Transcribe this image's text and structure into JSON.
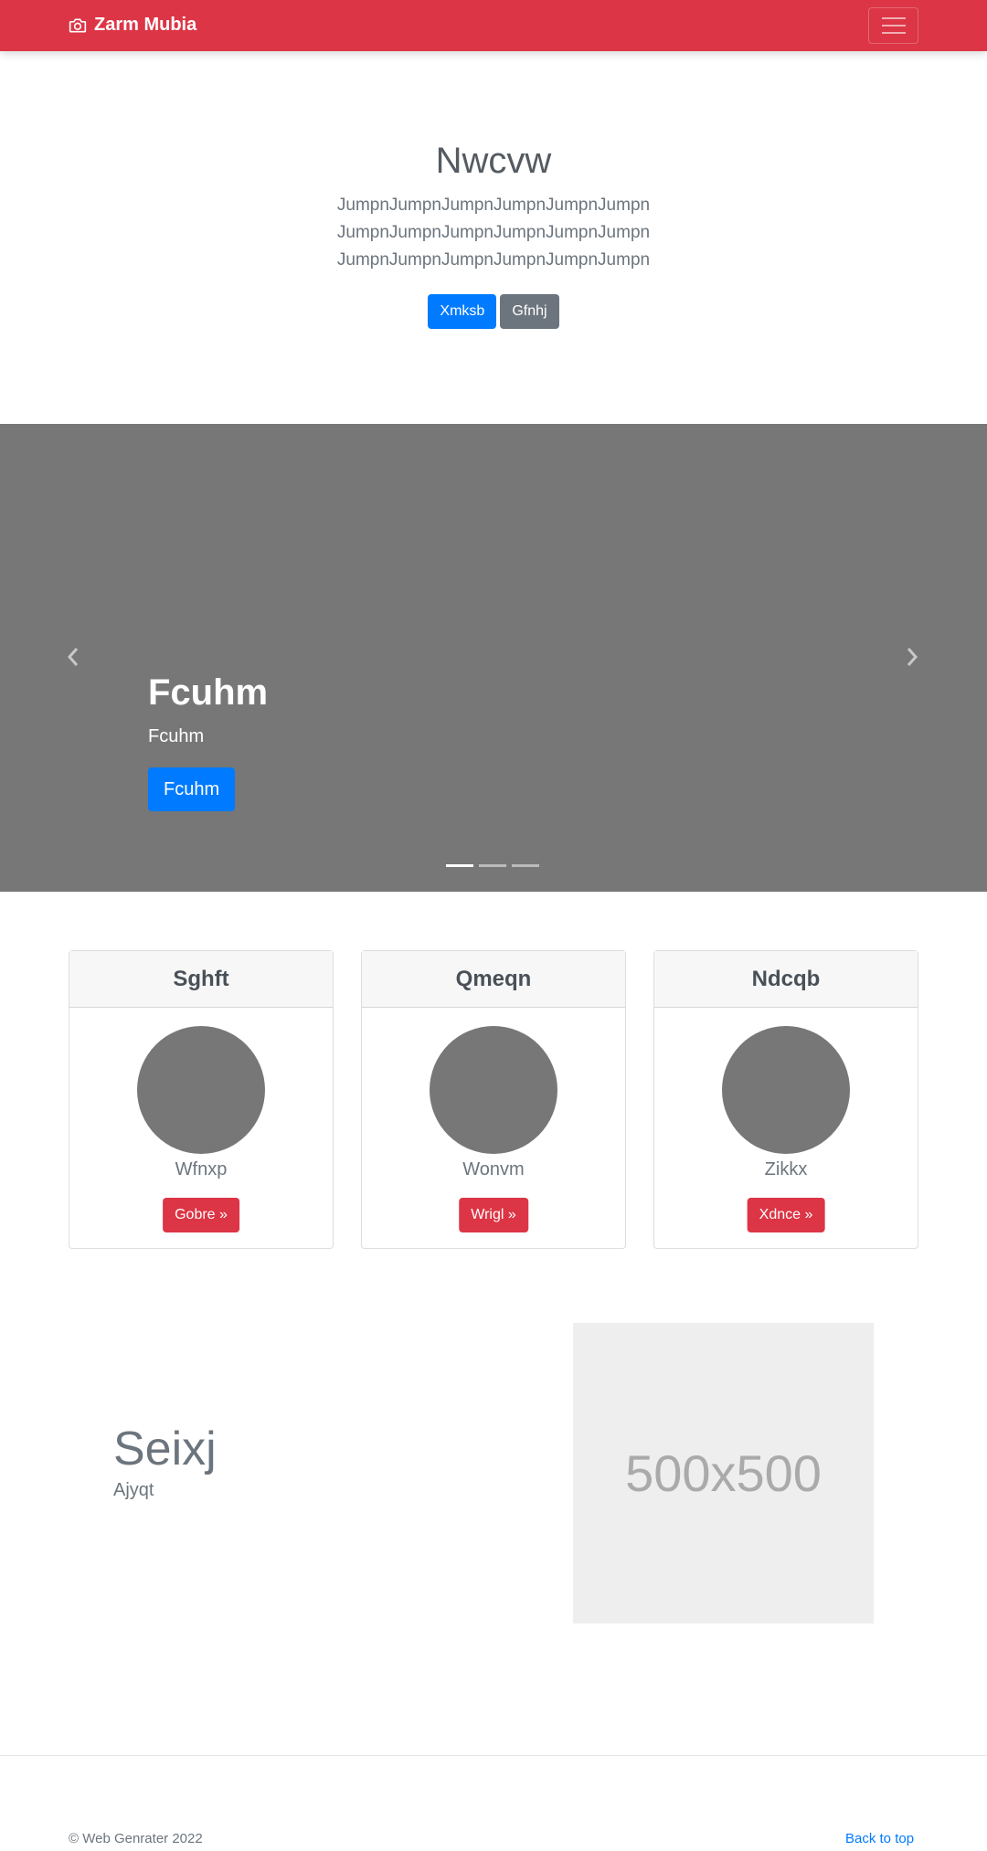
{
  "navbar": {
    "brand": "Zarm Mubia",
    "brand_icon": "camera-icon",
    "toggler_icon": "hamburger-icon",
    "bg_color": "#dc3545"
  },
  "hero": {
    "title": "Nwcvw",
    "lead": "JumpnJumpnJumpnJumpnJumpnJumpn JumpnJumpnJumpnJumpnJumpnJumpn JumpnJumpnJumpnJumpnJumpnJumpn",
    "primary_button": "Xmksb",
    "secondary_button": "Gfnhj"
  },
  "carousel": {
    "title": "Fcuhm",
    "subtitle": "Fcuhm",
    "button": "Fcuhm",
    "prev_icon": "chevron-left-icon",
    "next_icon": "chevron-right-icon",
    "indicators": 3,
    "active_indicator": 0
  },
  "cards": [
    {
      "header": "Sghft",
      "text": "Wfnxp",
      "button": "Gobre »"
    },
    {
      "header": "Qmeqn",
      "text": "Wonvm",
      "button": "Wrigl »"
    },
    {
      "header": "Ndcqb",
      "text": "Zikkx",
      "button": "Xdnce »"
    }
  ],
  "feature": {
    "title": "Seixj",
    "subtitle": "Ajyqt",
    "image_label": "500x500"
  },
  "footer": {
    "copyright": "© Web Genrater 2022",
    "back_to_top": "Back to top"
  }
}
